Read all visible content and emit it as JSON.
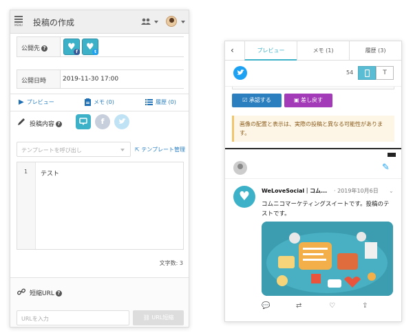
{
  "left": {
    "title": "投稿の作成",
    "menu_label": "MENU",
    "destination_label": "公開先",
    "publish_date_label": "公開日時",
    "publish_date_value": "2019-11-30 17:00",
    "tabs": [
      {
        "label": "プレビュー",
        "icon": "play-icon"
      },
      {
        "label": "メモ (0)",
        "icon": "clipboard-icon"
      },
      {
        "label": "履歴 (0)",
        "icon": "list-icon"
      }
    ],
    "content_label": "投稿内容",
    "template_placeholder": "テンプレートを呼び出し",
    "template_manage": "テンプレート管理",
    "editor_line_number": "1",
    "editor_text": "テスト",
    "char_count": "文字数: 3",
    "short_url_label": "短縮URL",
    "url_placeholder": "URLを入力",
    "url_button": "URL短縮"
  },
  "right": {
    "tabs": [
      "プレビュー",
      "メモ (1)",
      "履歴 (3)"
    ],
    "count": "54",
    "device_text_label": "T",
    "approve": "承認する",
    "reject": "差し戻す",
    "warning": "画像の配置と表示は、実際の投稿と異なる可能性があります。",
    "tweet": {
      "name": "WeLoveSocial｜コム...",
      "date": "· 2019年10月6日",
      "text": "コムニコマーケティングスイートです。投稿のテストです。"
    }
  },
  "colors": {
    "accent": "#3db1c8",
    "link": "#2a7fc1",
    "approve": "#2c7fbf",
    "reject": "#a33bb8",
    "twitter": "#1da1f2"
  }
}
